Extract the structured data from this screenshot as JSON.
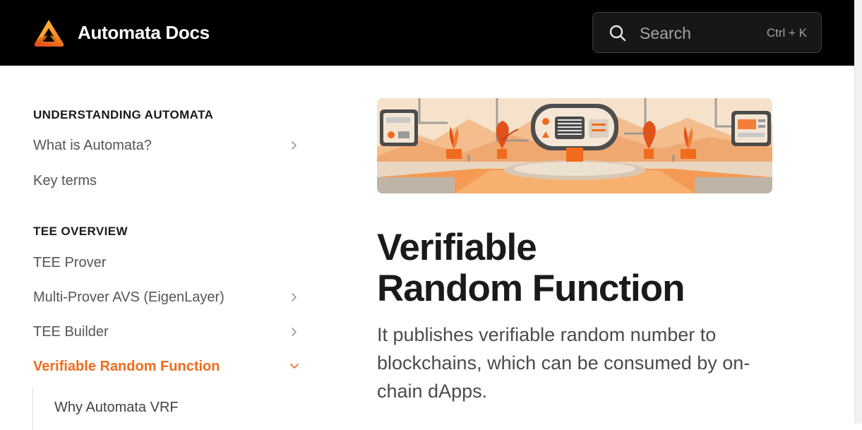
{
  "header": {
    "brand": "Automata Docs",
    "search_placeholder": "Search",
    "search_shortcut": "Ctrl + K"
  },
  "sidebar": {
    "sections": [
      {
        "title": "UNDERSTANDING AUTOMATA",
        "items": [
          {
            "label": "What is Automata?",
            "has_children": true
          },
          {
            "label": "Key terms",
            "has_children": false
          }
        ]
      },
      {
        "title": "TEE OVERVIEW",
        "items": [
          {
            "label": "TEE Prover",
            "has_children": false
          },
          {
            "label": "Multi-Prover AVS (EigenLayer)",
            "has_children": true
          },
          {
            "label": "TEE Builder",
            "has_children": true
          },
          {
            "label": "Verifiable Random Function",
            "has_children": true,
            "active": true,
            "expanded": true
          }
        ]
      }
    ],
    "sub_items": [
      "Why Automata VRF"
    ]
  },
  "main": {
    "title": "Verifiable Random Function",
    "title_line1": "Verifiable",
    "title_line2": "Random Function",
    "lead": "It publishes verifiable random number to blockchains, which can be consumed by on-chain dApps."
  },
  "colors": {
    "topbar": "#000000",
    "accent": "#f26b1d",
    "hero_bg": "#f4dcc1"
  },
  "icons": {
    "logo": "automata-logo-icon",
    "search": "search-icon",
    "chevron_right": "chevron-right-icon",
    "chevron_down": "chevron-down-icon"
  }
}
